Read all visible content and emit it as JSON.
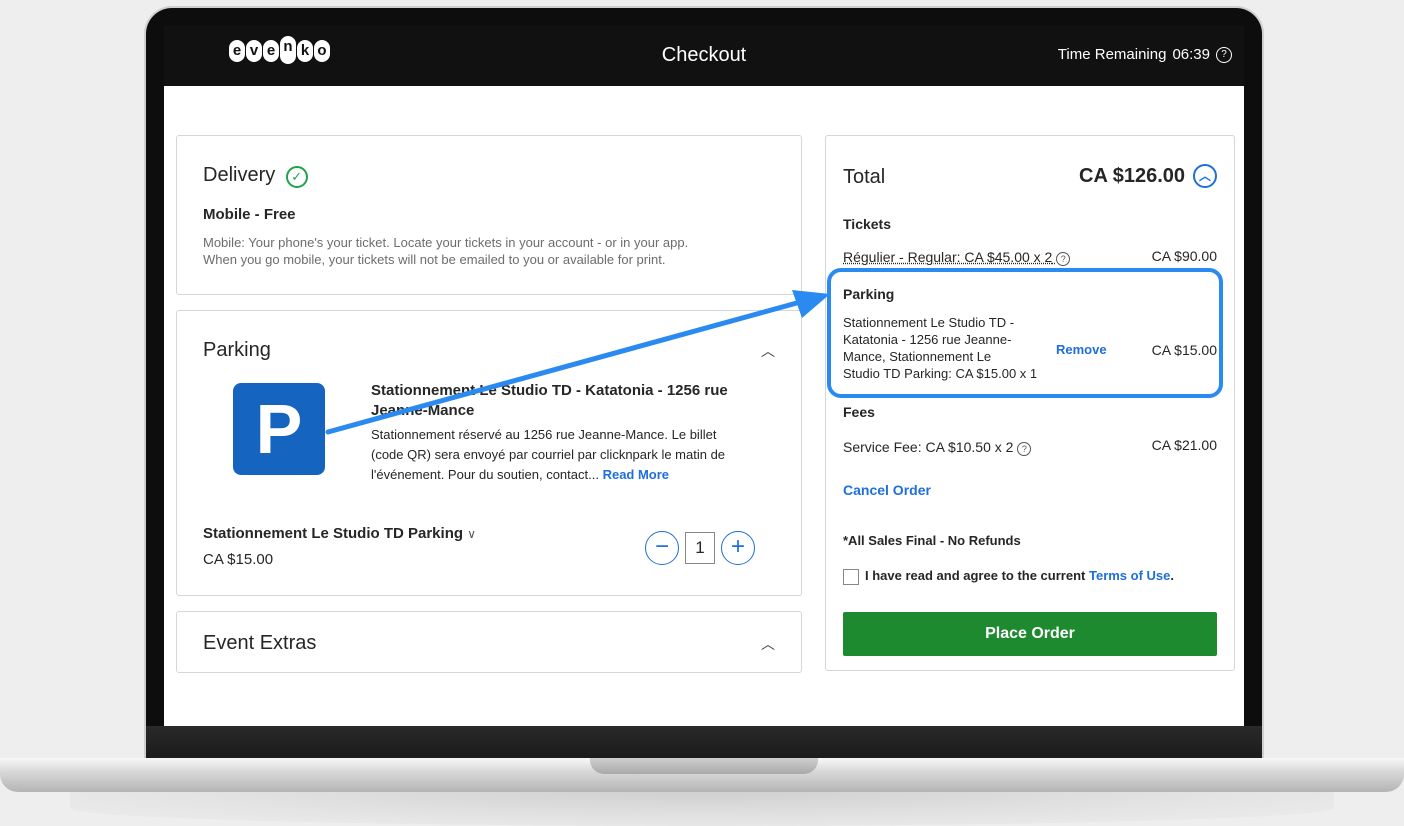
{
  "header": {
    "logo_letters": [
      "e",
      "v",
      "e",
      "n",
      "k",
      "o"
    ],
    "title": "Checkout",
    "timer_label": "Time Remaining",
    "timer_value": "06:39",
    "help_glyph": "?"
  },
  "delivery": {
    "title": "Delivery",
    "option": "Mobile - Free",
    "description_line1": "Mobile: Your phone's your ticket. Locate your tickets in your account - or in your app.",
    "description_line2": "When you go mobile, your tickets will not be emailed to you or available for print."
  },
  "parking": {
    "title": "Parking",
    "logo_letter": "P",
    "product_title": "Stationnement Le Studio TD - Katatonia - 1256 rue Jeanne-Mance",
    "product_desc_line1": "Stationnement réservé au 1256 rue Jeanne-Mance. Le billet",
    "product_desc_line2": "(code QR) sera envoyé par courriel par clicknpark le matin de",
    "product_desc_line3": "l'événement. Pour du soutien, contact...",
    "read_more": "Read More",
    "item_name": "Stationnement Le Studio TD Parking",
    "item_price": "CA $15.00",
    "quantity": "1",
    "minus": "−",
    "plus": "+"
  },
  "event_extras": {
    "title": "Event Extras"
  },
  "summary": {
    "total_label": "Total",
    "total_value": "CA $126.00",
    "tickets_label": "Tickets",
    "ticket_line": "Régulier - Regular: CA $45.00 x 2",
    "ticket_price": "CA $90.00",
    "parking_label": "Parking",
    "parking_desc_line1": "Stationnement Le Studio TD -",
    "parking_desc_line2": "Katatonia - 1256 rue Jeanne-",
    "parking_desc_line3": "Mance, Stationnement Le",
    "parking_desc_line4": "Studio TD Parking: CA $15.00 x 1",
    "remove": "Remove",
    "parking_price": "CA $15.00",
    "fees_label": "Fees",
    "fee_line": "Service Fee: CA $10.50 x 2",
    "fee_price": "CA $21.00",
    "cancel": "Cancel Order",
    "sales_final": "*All Sales Final - No Refunds",
    "agree_text": "I have read and agree to the current",
    "terms": "Terms of Use",
    "agree_end": ".",
    "place_order": "Place Order"
  },
  "colors": {
    "accent": "#1e6fd9",
    "place_order": "#1e8a2f",
    "highlight": "#2a8af0",
    "header_bg": "#111111"
  }
}
